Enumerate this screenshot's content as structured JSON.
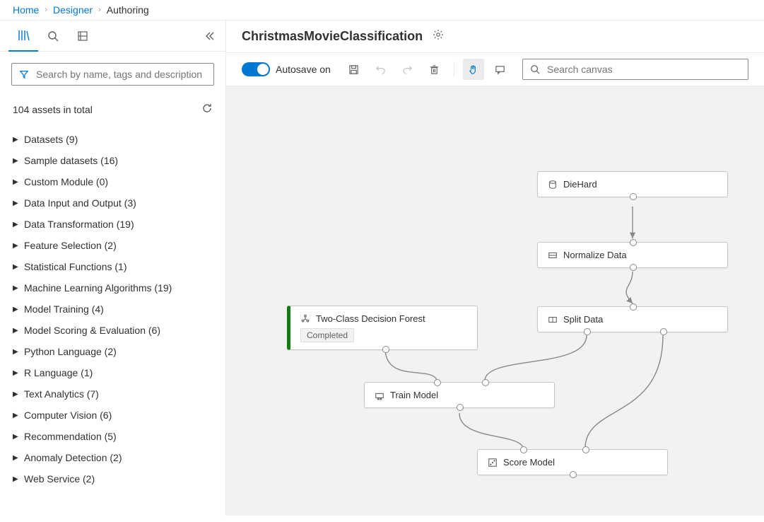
{
  "breadcrumb": {
    "home": "Home",
    "designer": "Designer",
    "authoring": "Authoring"
  },
  "sidebar": {
    "search_placeholder": "Search by name, tags and description",
    "assets_count": "104 assets in total",
    "items": [
      {
        "label": "Datasets (9)"
      },
      {
        "label": "Sample datasets (16)"
      },
      {
        "label": "Custom Module (0)"
      },
      {
        "label": "Data Input and Output (3)"
      },
      {
        "label": "Data Transformation (19)"
      },
      {
        "label": "Feature Selection (2)"
      },
      {
        "label": "Statistical Functions (1)"
      },
      {
        "label": "Machine Learning Algorithms (19)"
      },
      {
        "label": "Model Training (4)"
      },
      {
        "label": "Model Scoring & Evaluation (6)"
      },
      {
        "label": "Python Language (2)"
      },
      {
        "label": "R Language (1)"
      },
      {
        "label": "Text Analytics (7)"
      },
      {
        "label": "Computer Vision (6)"
      },
      {
        "label": "Recommendation (5)"
      },
      {
        "label": "Anomaly Detection (2)"
      },
      {
        "label": "Web Service (2)"
      }
    ]
  },
  "header": {
    "title": "ChristmasMovieClassification"
  },
  "toolbar": {
    "autosave_label": "Autosave on",
    "canvas_search_placeholder": "Search canvas"
  },
  "nodes": {
    "diehard": {
      "label": "DieHard"
    },
    "normalize": {
      "label": "Normalize Data"
    },
    "split": {
      "label": "Split Data"
    },
    "forest": {
      "label": "Two-Class Decision Forest",
      "status": "Completed"
    },
    "train": {
      "label": "Train Model"
    },
    "score": {
      "label": "Score Model"
    }
  }
}
